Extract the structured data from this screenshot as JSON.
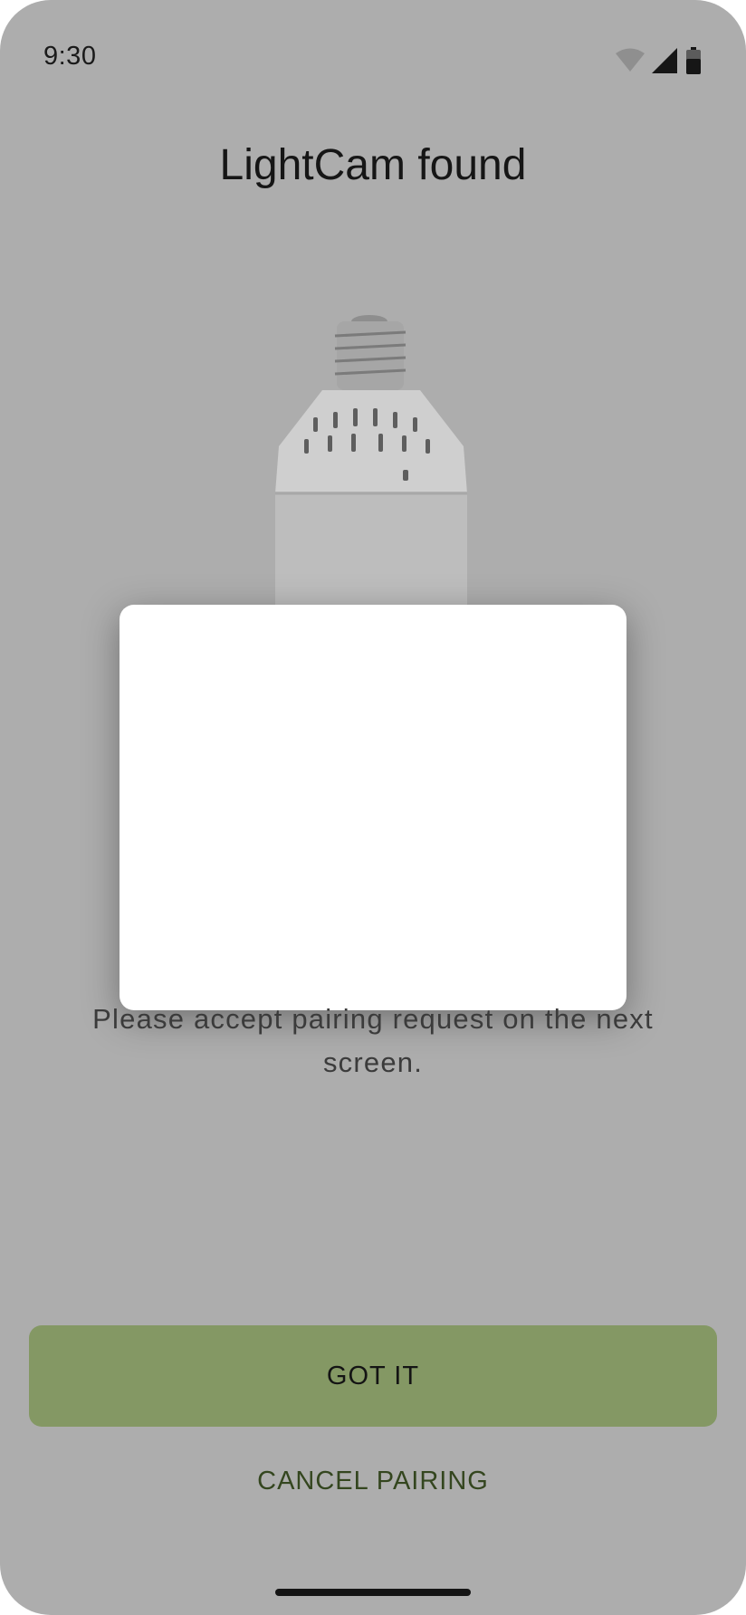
{
  "status_bar": {
    "time": "9:30",
    "icons": [
      "wifi-icon",
      "cellular-signal-icon",
      "battery-icon"
    ]
  },
  "screen": {
    "title": "LightCam found",
    "image": "lightcam-bulb-illustration",
    "message": "Please accept pairing request on the next screen.",
    "primary_button": "GOT IT",
    "secondary_button": "CANCEL PAIRING"
  },
  "colors": {
    "background": "#adadad",
    "primary_button": "#849864",
    "secondary_text": "#34461f",
    "dialog": "#ffffff"
  }
}
